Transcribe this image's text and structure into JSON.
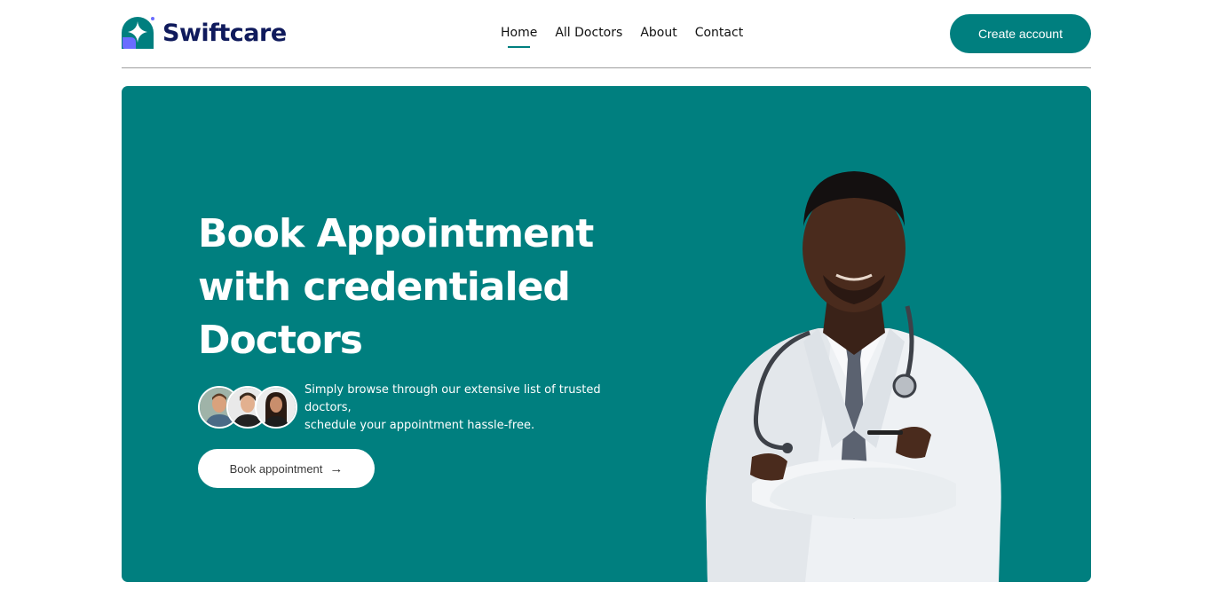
{
  "brand": {
    "name": "Swiftcare"
  },
  "nav": {
    "items": [
      {
        "label": "Home",
        "active": true
      },
      {
        "label": "All Doctors",
        "active": false
      },
      {
        "label": "About",
        "active": false
      },
      {
        "label": "Contact",
        "active": false
      }
    ]
  },
  "header": {
    "create_account_label": "Create account"
  },
  "hero": {
    "title_lines": [
      "Book Appointment",
      "with credentialed",
      "Doctors"
    ],
    "description_lines": [
      "Simply browse through our extensive list of trusted",
      "doctors,",
      "schedule your appointment hassle-free."
    ],
    "cta_label": "Book appointment",
    "cta_icon": "arrow-right-icon"
  },
  "colors": {
    "accent": "#007f7f",
    "brand_text": "#0f1a5c",
    "logo_secondary": "#6a6cff"
  }
}
